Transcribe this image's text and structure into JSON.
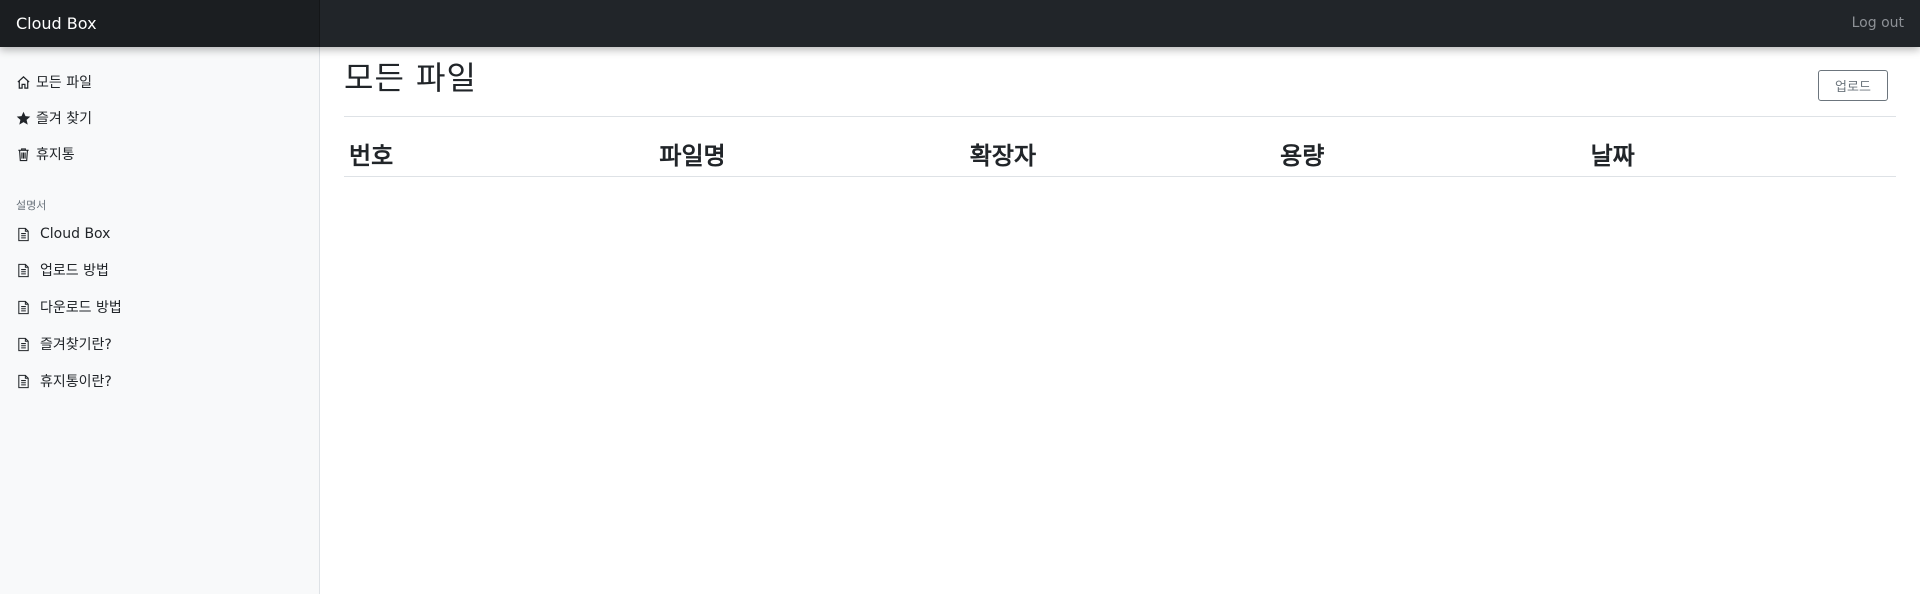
{
  "navbar": {
    "brand": "Cloud Box",
    "logout_label": "Log out"
  },
  "sidebar": {
    "main_items": [
      {
        "label": "모든 파일",
        "icon": "home-icon"
      },
      {
        "label": "즐겨 찾기",
        "icon": "star-icon"
      },
      {
        "label": "휴지통",
        "icon": "trash-icon"
      }
    ],
    "docs_heading": "설명서",
    "doc_items": [
      {
        "label": "Cloud Box",
        "icon": "file-icon"
      },
      {
        "label": "업로드 방법",
        "icon": "file-icon"
      },
      {
        "label": "다운로드 방법",
        "icon": "file-icon"
      },
      {
        "label": "즐겨찾기란?",
        "icon": "file-icon"
      },
      {
        "label": "휴지통이란?",
        "icon": "file-icon"
      }
    ]
  },
  "main": {
    "title": "모든 파일",
    "upload_label": "업로드",
    "table": {
      "columns": [
        "번호",
        "파일명",
        "확장자",
        "용량",
        "날짜"
      ],
      "rows": []
    }
  },
  "colors": {
    "navbar": "#212529",
    "brand_bg": "#1b1e21",
    "sidebar_bg": "#f8f9fa",
    "border": "#dee2e6",
    "muted": "#6c757d"
  }
}
